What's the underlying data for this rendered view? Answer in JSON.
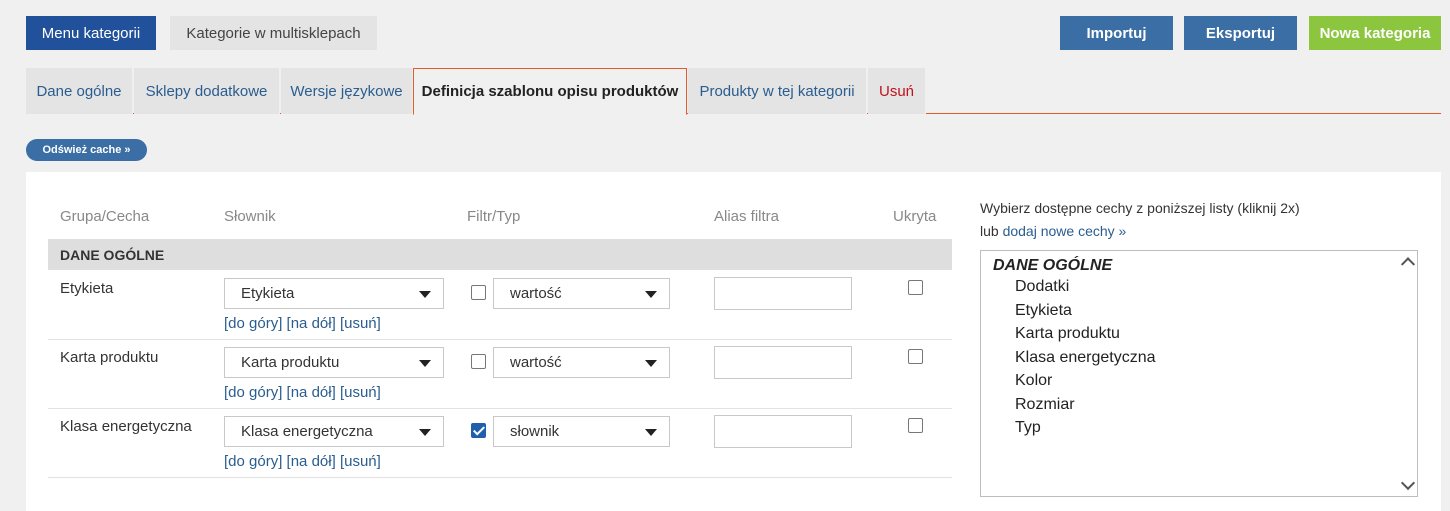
{
  "top_buttons": {
    "menu": "Menu kategorii",
    "multishop": "Kategorie w multisklepach",
    "import": "Importuj",
    "export": "Eksportuj",
    "new_category": "Nowa kategoria"
  },
  "tabs": [
    {
      "label": "Dane ogólne"
    },
    {
      "label": "Sklepy dodatkowe"
    },
    {
      "label": "Wersje językowe"
    },
    {
      "label": "Definicja szablonu opisu produktów"
    },
    {
      "label": "Produkty w tej kategorii"
    },
    {
      "label": "Usuń"
    }
  ],
  "refresh_button": "Odśwież cache »",
  "table": {
    "headers": {
      "group": "Grupa/Cecha",
      "dictionary": "Słownik",
      "filter": "Filtr/Typ",
      "alias": "Alias filtra",
      "hidden": "Ukryta"
    },
    "group_title": "DANE OGÓLNE",
    "rows": [
      {
        "label": "Etykieta",
        "dictionary": "Etykieta",
        "filter_checked": false,
        "type": "wartość",
        "alias": "",
        "hidden": false
      },
      {
        "label": "Karta produktu",
        "dictionary": "Karta produktu",
        "filter_checked": false,
        "type": "wartość",
        "alias": "",
        "hidden": false
      },
      {
        "label": "Klasa energetyczna",
        "dictionary": "Klasa energetyczna",
        "filter_checked": true,
        "type": "słownik",
        "alias": "",
        "hidden": false
      }
    ],
    "row_links": {
      "up": "[do góry]",
      "down": "[na dół]",
      "remove": "[usuń]"
    }
  },
  "right_panel": {
    "instruction": "Wybierz dostępne cechy z poniższej listy (kliknij 2x)",
    "or_text": "lub",
    "add_link": "dodaj nowe cechy »",
    "list_group": "DANE OGÓLNE",
    "list_items": [
      "Dodatki",
      "Etykieta",
      "Karta produktu",
      "Klasa energetyczna",
      "Kolor",
      "Rozmiar",
      "Typ"
    ]
  }
}
